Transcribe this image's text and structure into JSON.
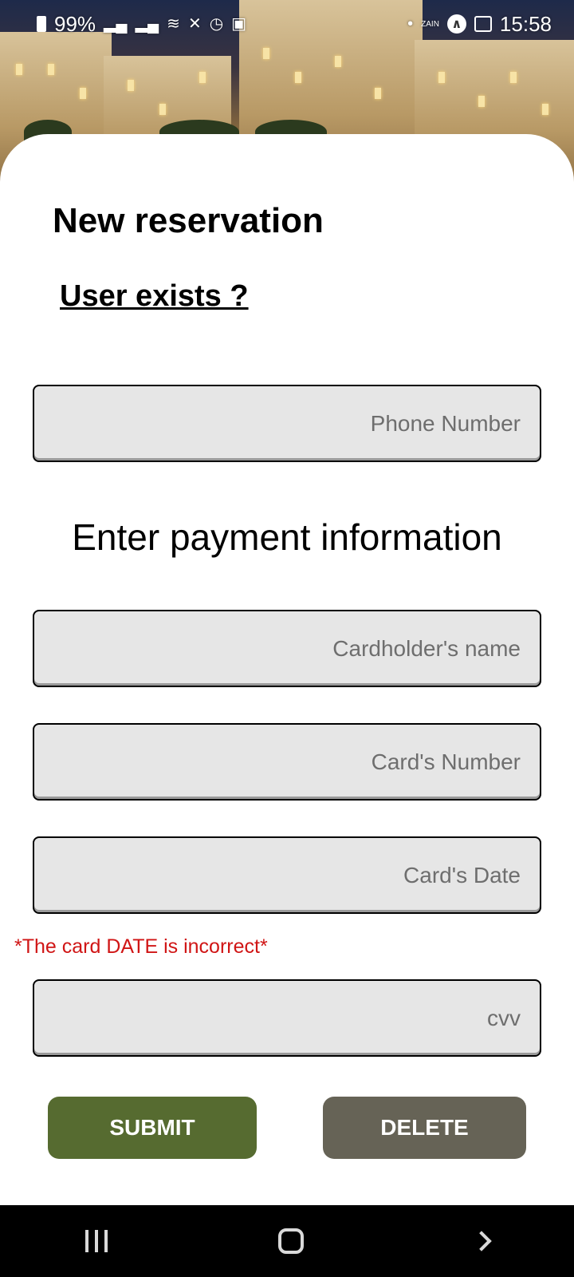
{
  "status_bar": {
    "battery": "99%",
    "time": "15:58",
    "carrier_text": "ZAIN"
  },
  "page": {
    "title": "New reservation",
    "user_exists_link": "User exists ?"
  },
  "phone_field": {
    "placeholder": "Phone Number"
  },
  "payment": {
    "section_title": "Enter payment information",
    "cardholder_placeholder": "Cardholder's name",
    "card_number_placeholder": "Card's Number",
    "card_date_placeholder": "Card's Date",
    "date_error": "*The card DATE is incorrect*",
    "cvv_placeholder": "cvv"
  },
  "buttons": {
    "submit": "SUBMIT",
    "delete": "DELETE"
  },
  "colors": {
    "submit_bg": "#566b30",
    "delete_bg": "#666356",
    "error": "#d01515"
  }
}
